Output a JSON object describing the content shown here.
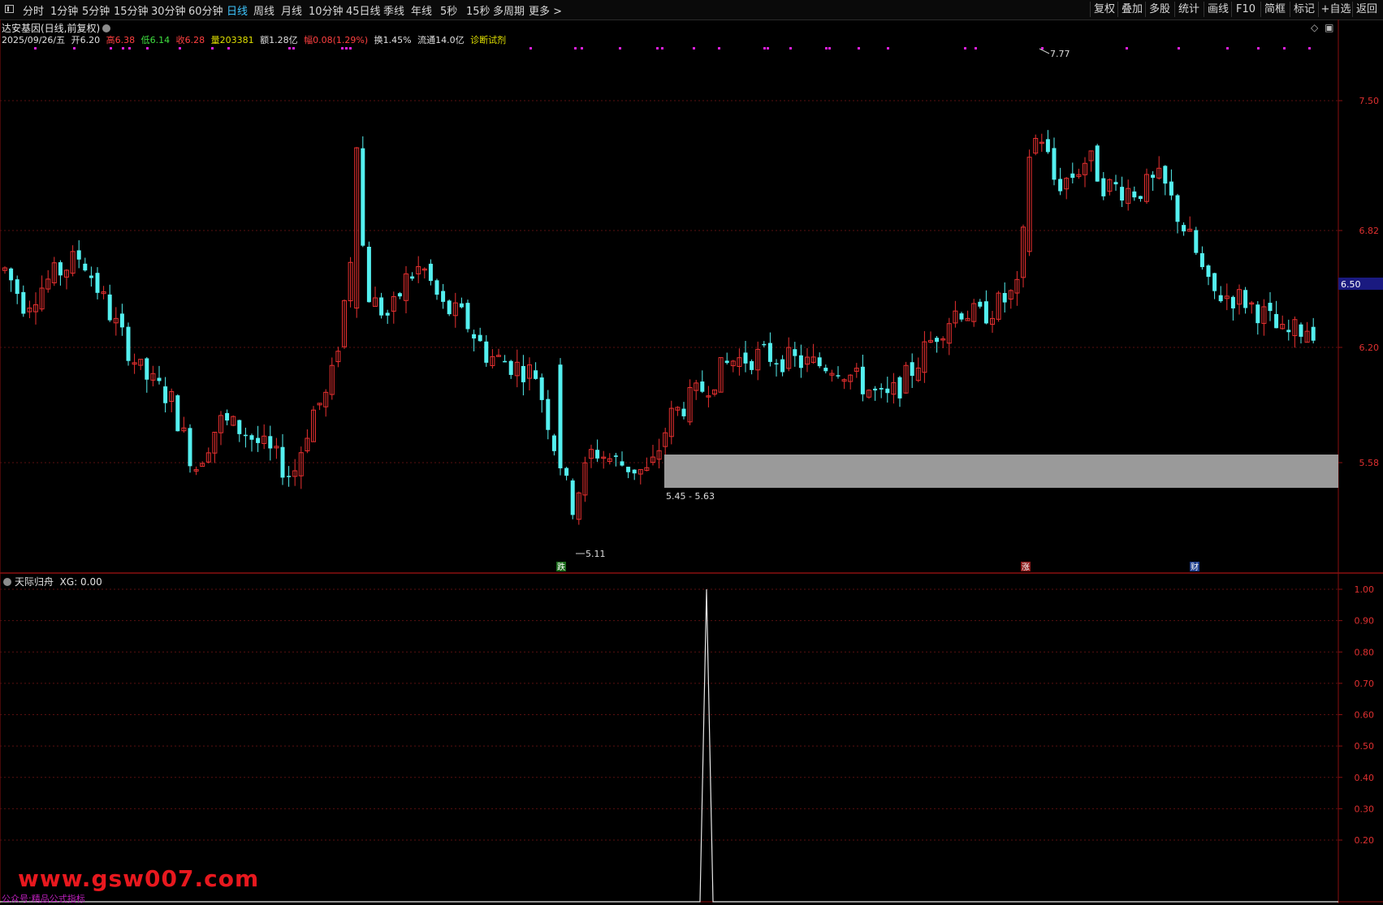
{
  "toolbar": {
    "periods": [
      "分时",
      "1分钟",
      "5分钟",
      "15分钟",
      "30分钟",
      "60分钟",
      "日线",
      "周线",
      "月线",
      "10分钟",
      "45日线",
      "季线",
      "年线",
      "5秒",
      "15秒",
      "多周期",
      "更多 >"
    ],
    "active_period": "日线",
    "right_buttons": [
      "复权",
      "叠加",
      "多股",
      "统计",
      "画线",
      "F10",
      "简框",
      "标记",
      "+自选",
      "返回"
    ]
  },
  "header": {
    "title": "达安基因(日线,前复权)",
    "date": "2025/09/26/五",
    "open": "开6.20",
    "high": "高6.38",
    "low": "低6.14",
    "close": "收6.28",
    "volume": "量203381",
    "amount": "额1.28亿",
    "change": "幅0.08(1.29%)",
    "turnover": "换1.45%",
    "float_cap": "流通14.0亿",
    "diagnose_link": "诊断试剂"
  },
  "price_axis": {
    "labels": [
      "7.50",
      "6.82",
      "6.50",
      "6.20",
      "5.58"
    ],
    "current_price": "6.50"
  },
  "annotations": {
    "high_label": "7.77",
    "low_label": "5.11",
    "zone_label": "5.45 - 5.63",
    "tag_fall": "跌",
    "tag_rise": "涨",
    "tag_finance": "财"
  },
  "indicator": {
    "name": "天际归舟",
    "value_label": "XG: 0.00",
    "axis_labels": [
      "1.00",
      "0.90",
      "0.80",
      "0.70",
      "0.60",
      "0.50",
      "0.40",
      "0.30",
      "0.20"
    ]
  },
  "colors": {
    "up": "#e83030",
    "down": "#54f0f0",
    "grid": "#5a1010",
    "marker_dots": "#e020e0",
    "active_tab": "#3ec6ff",
    "zone": "#9a9a9a"
  },
  "watermark": {
    "site": "www.gsw007.com",
    "sub": "公众号:精品公式指标"
  }
}
